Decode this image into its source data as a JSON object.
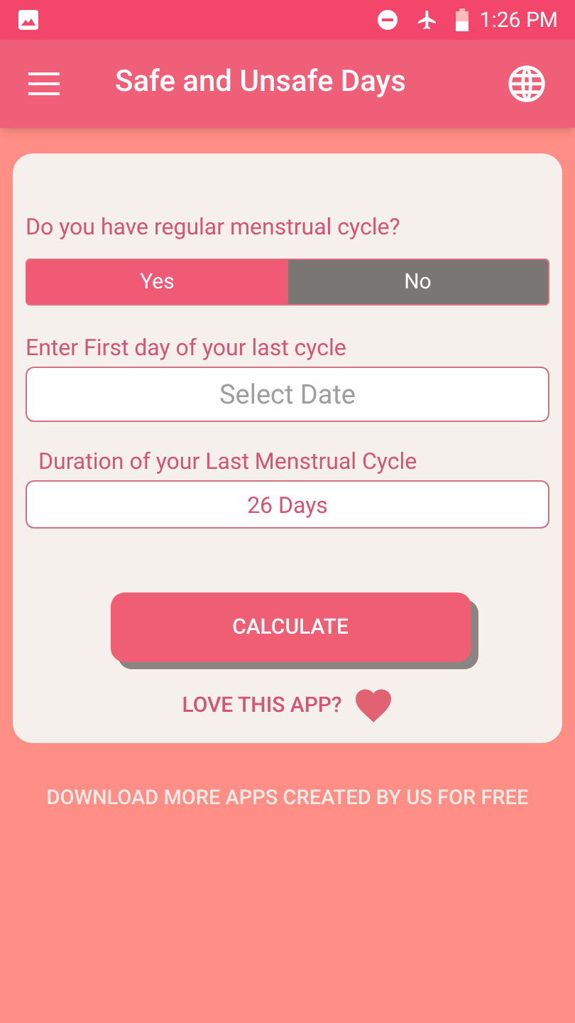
{
  "status_bar": {
    "time": "1:26 PM"
  },
  "app_bar": {
    "title": "Safe and Unsafe Days"
  },
  "form": {
    "question": "Do you have regular menstrual cycle?",
    "options": [
      {
        "label": "Yes",
        "selected": true
      },
      {
        "label": "No",
        "selected": false
      }
    ],
    "date_label": "Enter First day of your last cycle",
    "date_field": {
      "placeholder": "Select Date"
    },
    "duration_label": "Duration of your Last Menstrual Cycle",
    "duration_field": {
      "value": "26 Days"
    },
    "calculate_button": "CALCULATE",
    "love_text": "LOVE THIS APP?"
  },
  "footer_link": "DOWNLOAD MORE APPS CREATED BY US FOR FREE"
}
